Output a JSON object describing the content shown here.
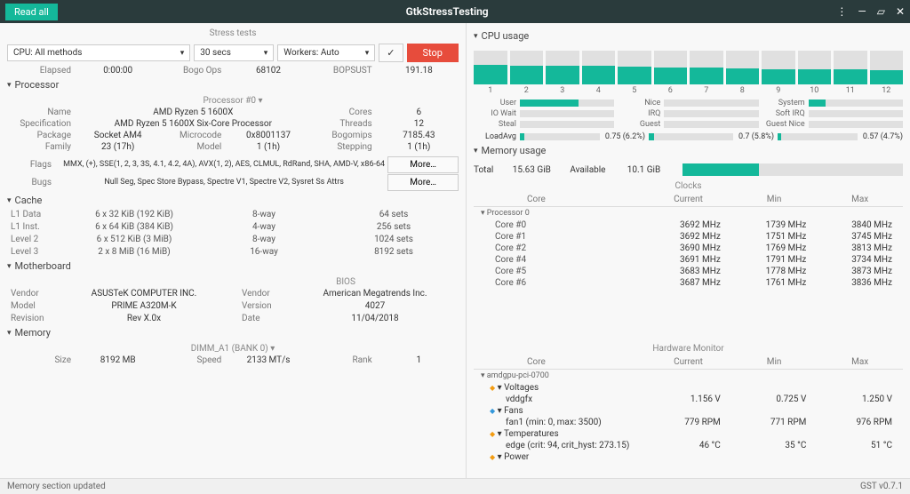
{
  "titlebar": {
    "read_all": "Read all",
    "title": "GtkStressTesting"
  },
  "stress": {
    "header": "Stress tests",
    "cpu_method": "CPU: All methods",
    "duration": "30 secs",
    "workers": "Workers: Auto",
    "stop": "Stop",
    "elapsed_lbl": "Elapsed",
    "elapsed_val": "0:00:00",
    "bogo_lbl": "Bogo Ops",
    "bogo_val": "68102",
    "bops_lbl": "BOPSUST",
    "bops_val": "191.18"
  },
  "processor": {
    "header": "Processor",
    "subhdr": "Processor #0  ▾",
    "name_lbl": "Name",
    "name": "AMD Ryzen 5 1600X",
    "cores_lbl": "Cores",
    "cores": "6",
    "spec_lbl": "Specification",
    "spec": "AMD Ryzen 5 1600X Six-Core Processor",
    "threads_lbl": "Threads",
    "threads": "12",
    "pkg_lbl": "Package",
    "pkg": "Socket AM4",
    "micro_lbl": "Microcode",
    "micro": "0x8001137",
    "bogom_lbl": "Bogomips",
    "bogom": "7185.43",
    "fam_lbl": "Family",
    "fam": "23 (17h)",
    "model_lbl": "Model",
    "model": "1 (1h)",
    "step_lbl": "Stepping",
    "step": "1 (1h)",
    "flags_lbl": "Flags",
    "flags": "MMX, (+), SSE(1, 2, 3, 3S, 4.1, 4.2, 4A), AVX(1, 2), AES, CLMUL, RdRand, SHA, AMD-V, x86-64",
    "bugs_lbl": "Bugs",
    "bugs": "Null Seg, Spec Store Bypass, Spectre V1, Spectre V2, Sysret Ss Attrs",
    "more": "More…"
  },
  "cache": {
    "header": "Cache",
    "rows": [
      {
        "n": "L1 Data",
        "s": "6 x 32 KiB (192 KiB)",
        "w": "8-way",
        "sets": "64 sets"
      },
      {
        "n": "L1 Inst.",
        "s": "6 x 64 KiB (384 KiB)",
        "w": "4-way",
        "sets": "256 sets"
      },
      {
        "n": "Level 2",
        "s": "6 x 512 KiB (3 MiB)",
        "w": "8-way",
        "sets": "1024 sets"
      },
      {
        "n": "Level 3",
        "s": "2 x 8 MiB (16 MiB)",
        "w": "16-way",
        "sets": "8192 sets"
      }
    ]
  },
  "mobo": {
    "header": "Motherboard",
    "bios_hdr": "BIOS",
    "vendor_lbl": "Vendor",
    "vendor": "ASUSTeK COMPUTER INC.",
    "model_lbl": "Model",
    "model": "PRIME A320M-K",
    "rev_lbl": "Revision",
    "rev": "Rev X.0x",
    "bvendor_lbl": "Vendor",
    "bvendor": "American Megatrends Inc.",
    "bver_lbl": "Version",
    "bver": "4027",
    "bdate_lbl": "Date",
    "bdate": "11/04/2018"
  },
  "memory": {
    "header": "Memory",
    "dimm": "DIMM_A1 (BANK 0)  ▾",
    "size_lbl": "Size",
    "size": "8192 MB",
    "speed_lbl": "Speed",
    "speed": "2133 MT/s",
    "rank_lbl": "Rank",
    "rank": "1"
  },
  "cpu_usage": {
    "header": "CPU usage",
    "bars": [
      58,
      56,
      55,
      54,
      52,
      50,
      50,
      48,
      46,
      45,
      44,
      42
    ],
    "labels": {
      "user": "User",
      "nice": "Nice",
      "system": "System",
      "iowait": "IO Wait",
      "irq": "IRQ",
      "softirq": "Soft IRQ",
      "steal": "Steal",
      "guest": "Guest",
      "guestnice": "Guest Nice"
    },
    "user_pct": 62,
    "system_pct": 18,
    "loadavg_lbl": "LoadAvg",
    "la": [
      {
        "t": "0.75 (6.2%)",
        "p": 6
      },
      {
        "t": "0.7 (5.8%)",
        "p": 6
      },
      {
        "t": "0.57 (4.7%)",
        "p": 5
      }
    ]
  },
  "mem_usage": {
    "header": "Memory usage",
    "total_lbl": "Total",
    "total": "15.63 GiB",
    "avail_lbl": "Available",
    "avail": "10.1 GiB",
    "pct": 35
  },
  "clocks": {
    "header": "Clocks",
    "cols": {
      "c0": "Core",
      "c1": "Current",
      "c2": "Min",
      "c3": "Max"
    },
    "proc": "Processor 0",
    "rows": [
      {
        "n": "Core #0",
        "cur": "3692 MHz",
        "min": "1739 MHz",
        "max": "3840 MHz"
      },
      {
        "n": "Core #1",
        "cur": "3692 MHz",
        "min": "1751 MHz",
        "max": "3745 MHz"
      },
      {
        "n": "Core #2",
        "cur": "3690 MHz",
        "min": "1769 MHz",
        "max": "3813 MHz"
      },
      {
        "n": "Core #4",
        "cur": "3691 MHz",
        "min": "1791 MHz",
        "max": "3734 MHz"
      },
      {
        "n": "Core #5",
        "cur": "3683 MHz",
        "min": "1778 MHz",
        "max": "3873 MHz"
      },
      {
        "n": "Core #6",
        "cur": "3687 MHz",
        "min": "1761 MHz",
        "max": "3836 MHz"
      }
    ]
  },
  "hwmon": {
    "header": "Hardware Monitor",
    "cols": {
      "c0": "Core",
      "c1": "Current",
      "c2": "Min",
      "c3": "Max"
    },
    "dev": "amdgpu-pci-0700",
    "volt_hdr": "Voltages",
    "volt": {
      "n": "vddgfx",
      "cur": "1.156 V",
      "min": "0.725 V",
      "max": "1.250 V"
    },
    "fans_hdr": "Fans",
    "fan": {
      "n": "fan1 (min: 0, max: 3500)",
      "cur": "779 RPM",
      "min": "771 RPM",
      "max": "976 RPM"
    },
    "temp_hdr": "Temperatures",
    "temp": {
      "n": "edge (crit: 94, crit_hyst:  273.15)",
      "cur": "46 °C",
      "min": "35 °C",
      "max": "51 °C"
    },
    "power_hdr": "Power"
  },
  "status": {
    "left": "Memory section updated",
    "right": "GST v0.7.1"
  }
}
